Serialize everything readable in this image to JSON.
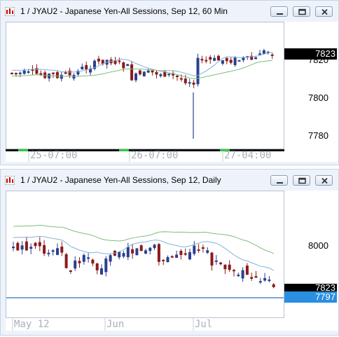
{
  "top_window": {
    "title": "1 / JYAU2 - Japanese Yen-All Sessions, Sep 12, 60 Min",
    "y_labels": [
      "7820",
      "7800",
      "7780"
    ],
    "last_price_tag": "7823",
    "x_labels": [
      "25-07:00",
      "26-07:00",
      "27-04:00"
    ]
  },
  "bottom_window": {
    "title": "1 / JYAU2 - Japanese Yen-All Sessions, Sep 12, Daily",
    "y_labels": [
      "8000"
    ],
    "last_price_tag": "7823",
    "line_price_tag": "7797",
    "x_labels": [
      "May 12",
      "Jun",
      "Jul"
    ]
  },
  "window_buttons": [
    "minimize",
    "restore",
    "close"
  ],
  "colors": {
    "up_candle": "#2a3f8f",
    "down_candle": "#8b1a1a",
    "ma_fast": "#7fb2dc",
    "ma_slow": "#7cbf7c",
    "price_line": "#2a74b8",
    "tag_black": "#000000",
    "tag_blue": "#2a8fe0"
  }
}
